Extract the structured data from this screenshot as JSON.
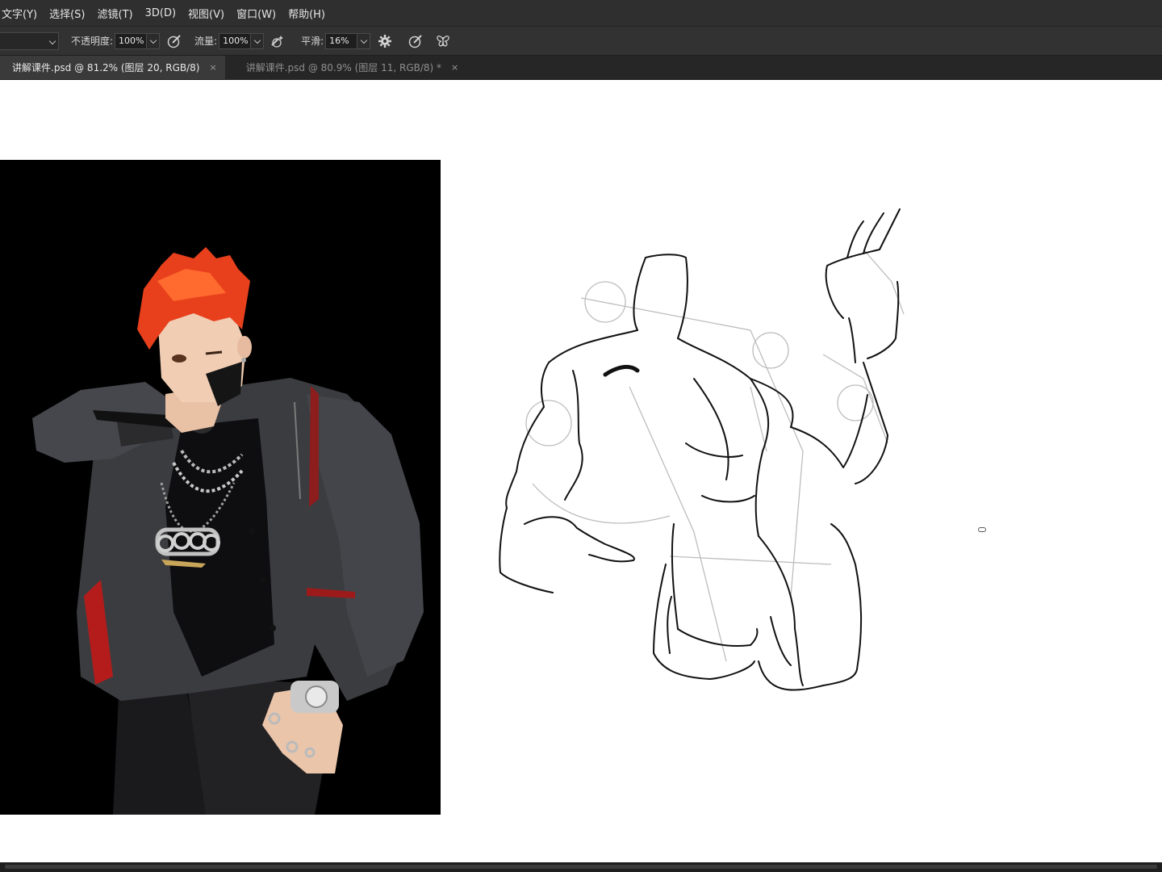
{
  "menubar": {
    "items": [
      "文字(Y)",
      "选择(S)",
      "滤镜(T)",
      "3D(D)",
      "视图(V)",
      "窗口(W)",
      "帮助(H)"
    ]
  },
  "options": {
    "opacity_label": "不透明度:",
    "opacity_value": "100%",
    "flow_label": "流量:",
    "flow_value": "100%",
    "smoothing_label": "平滑:",
    "smoothing_value": "16%"
  },
  "tabs": [
    {
      "label": "讲解课件.psd @ 81.2% (图层 20, RGB/8)",
      "close": "×",
      "active": true
    },
    {
      "label": "讲解课件.psd @ 80.9% (图层 11, RGB/8) *",
      "close": "×",
      "active": false
    }
  ],
  "icons": [
    "chevron-down-icon",
    "pressure-opacity-icon",
    "airbrush-icon",
    "settings-gear-icon",
    "pressure-size-icon",
    "symmetry-butterfly-icon",
    "close-icon"
  ],
  "colors": {
    "menubar_bg": "#2f2f2f",
    "options_bg": "#323232",
    "tabbar_bg": "#262626",
    "active_tab_bg": "#3a3a3a",
    "canvas_bg": "#ffffff",
    "reference_bg": "#000000",
    "hair": "#e8401c"
  }
}
